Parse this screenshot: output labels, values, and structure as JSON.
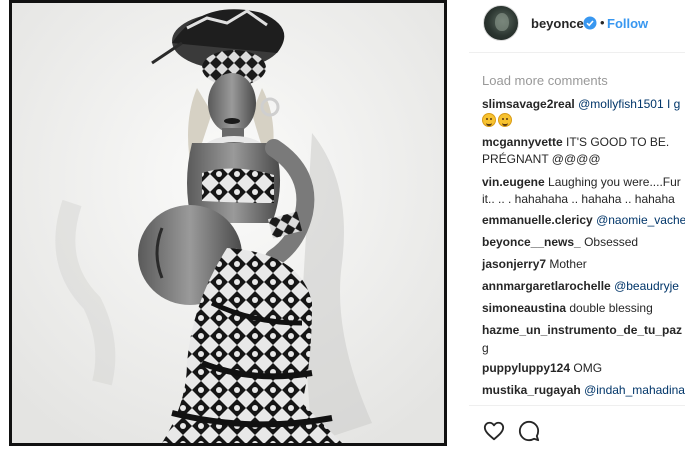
{
  "post": {
    "image_alt": "Black and white portrait photo",
    "username": "beyonce",
    "verified_icon": "verified-badge-icon",
    "separator": "•",
    "follow_label": "Follow",
    "accent_color": "#3897f0"
  },
  "comments_section": {
    "load_more_label": "Load more comments",
    "comments": [
      {
        "user": "slimsavage2real",
        "text": "@mollyfish1501 I g",
        "mention": true
      },
      {
        "user": "mcgannyvette",
        "text": "IT'S GOOD TO BE. PRÉGNANT @@@@",
        "mention": false
      },
      {
        "user": "vin.eugene",
        "text": "Laughing you were....Fur it.. .. . hahahaha .. hahaha .. hahaha",
        "mention": false
      },
      {
        "user": "emmanuelle.clericy",
        "text": "@naomie_vache",
        "mention": true
      },
      {
        "user": "beyonce__news_",
        "text": "Obsessed",
        "mention": false
      },
      {
        "user": "jasonjerry7",
        "text": "Mother",
        "mention": false
      },
      {
        "user": "annmargaretlarochelle",
        "text": "@beaudryje",
        "mention": true
      },
      {
        "user": "simoneaustina",
        "text": "double blessing",
        "mention": false
      },
      {
        "user": "hazme_un_instrumento_de_tu_paz",
        "text": "g",
        "mention": false
      },
      {
        "user": "puppyluppy124",
        "text": "OMG",
        "mention": false
      },
      {
        "user": "mustika_rugayah",
        "text": "@indah_mahadina",
        "mention": true
      }
    ],
    "emojis": [
      "grinning-face-icon",
      "grinning-face-icon"
    ]
  },
  "actions": {
    "like_icon": "heart-icon",
    "comment_icon": "comment-icon"
  }
}
